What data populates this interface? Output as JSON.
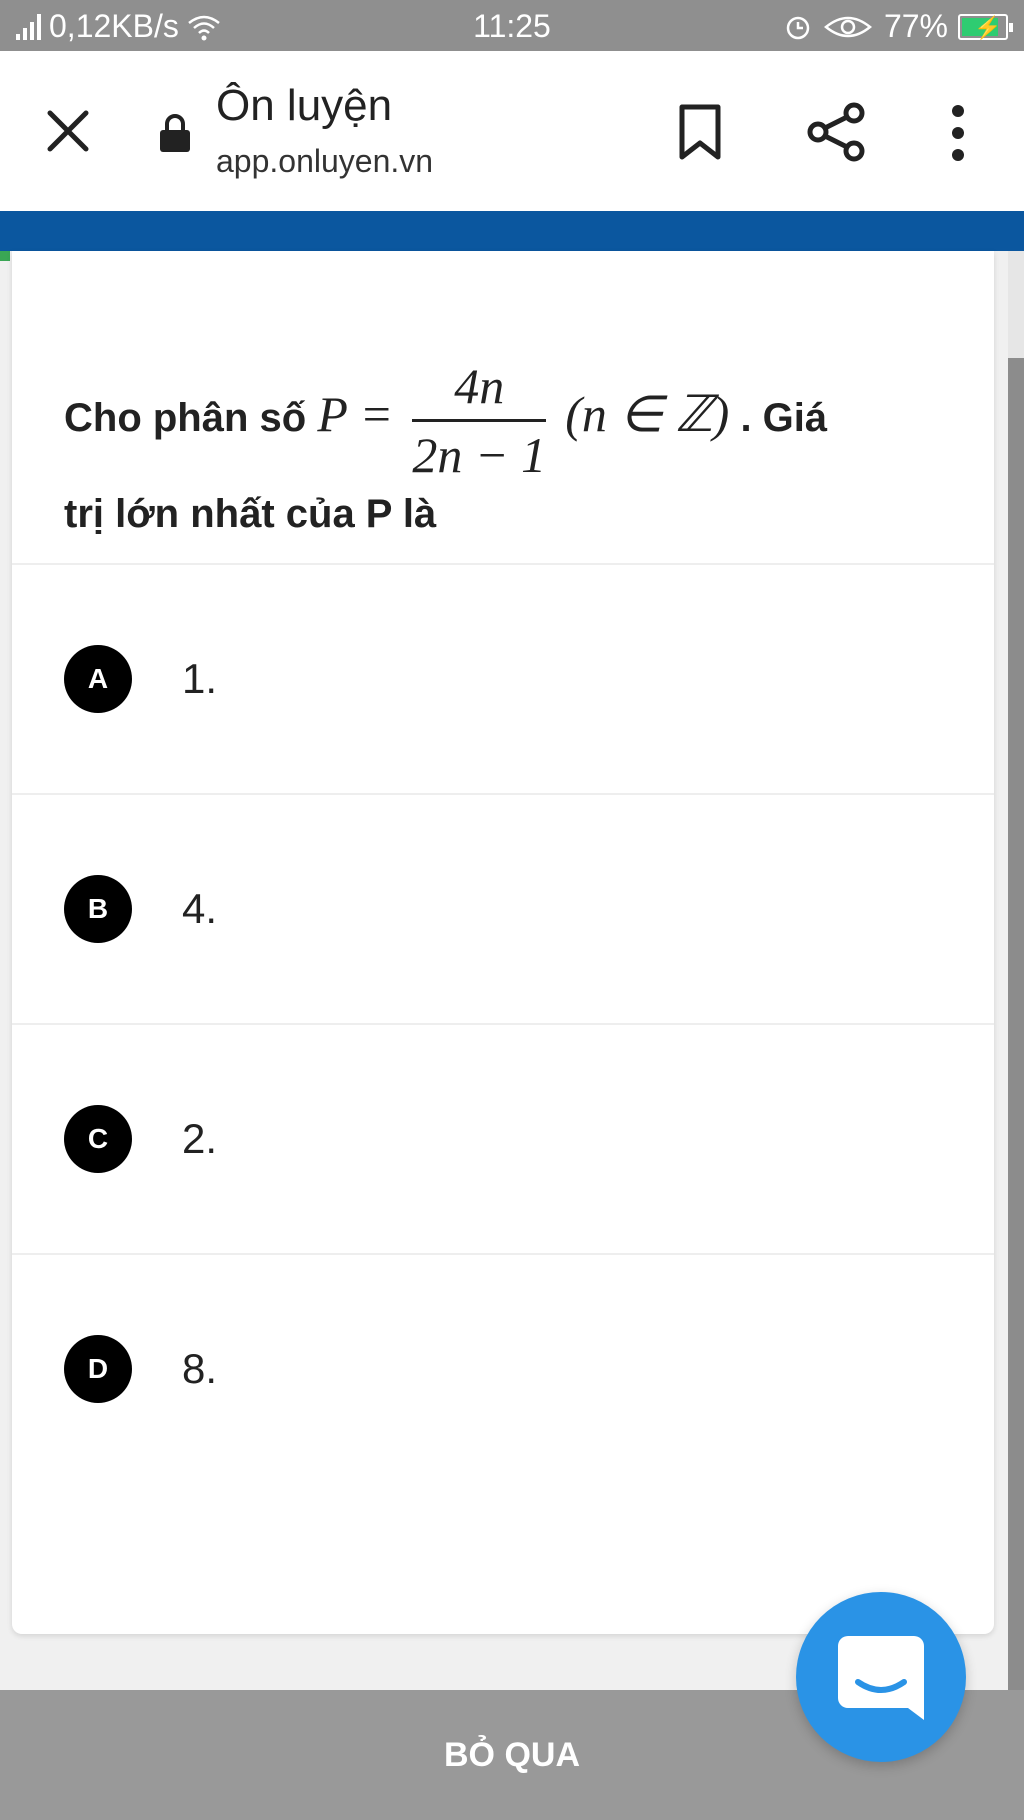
{
  "status_bar": {
    "speed": "0,12KB/s",
    "time": "11:25",
    "battery": "77%"
  },
  "browser": {
    "title": "Ôn luyện",
    "url": "app.onluyen.vn"
  },
  "question": {
    "prefix": "Cho phân số",
    "lhs": "P =",
    "numerator": "4n",
    "denominator": "2n − 1",
    "condition": "(n ∈ ℤ)",
    "suffix": ". Giá",
    "line2": "trị lớn nhất của P là"
  },
  "options": [
    {
      "letter": "A",
      "value": "1."
    },
    {
      "letter": "B",
      "value": "4."
    },
    {
      "letter": "C",
      "value": "2."
    },
    {
      "letter": "D",
      "value": "8."
    }
  ],
  "footer": {
    "skip_label": "BỎ QUA"
  },
  "colors": {
    "header": "#0b579f",
    "fab": "#2a93e6",
    "bottom_bar": "#999999"
  }
}
